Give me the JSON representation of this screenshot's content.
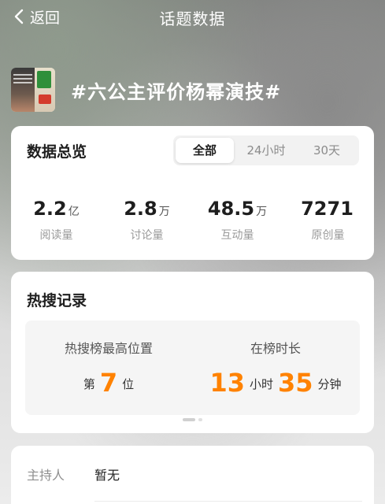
{
  "topbar": {
    "back_label": "返回",
    "title": "话题数据"
  },
  "topic": {
    "name": "#六公主评价杨幂演技#"
  },
  "overview": {
    "title": "数据总览",
    "tabs": [
      {
        "label": "全部",
        "active": true
      },
      {
        "label": "24小时",
        "active": false
      },
      {
        "label": "30天",
        "active": false
      }
    ],
    "stats": [
      {
        "value": "2.2",
        "unit": "亿",
        "label": "阅读量"
      },
      {
        "value": "2.8",
        "unit": "万",
        "label": "讨论量"
      },
      {
        "value": "48.5",
        "unit": "万",
        "label": "互动量"
      },
      {
        "value": "7271",
        "unit": "",
        "label": "原创量"
      }
    ]
  },
  "hot_search": {
    "title": "热搜记录",
    "peak_label": "热搜榜最高位置",
    "peak_prefix": "第",
    "peak_value": "7",
    "peak_suffix": "位",
    "duration_label": "在榜时长",
    "hours": "13",
    "hours_unit": "小时",
    "minutes": "35",
    "minutes_unit": "分钟"
  },
  "host": {
    "label": "主持人",
    "value": "暂无"
  },
  "colors": {
    "accent": "#ff8200",
    "card": "#ffffff",
    "muted_text": "#9a9a9a"
  }
}
